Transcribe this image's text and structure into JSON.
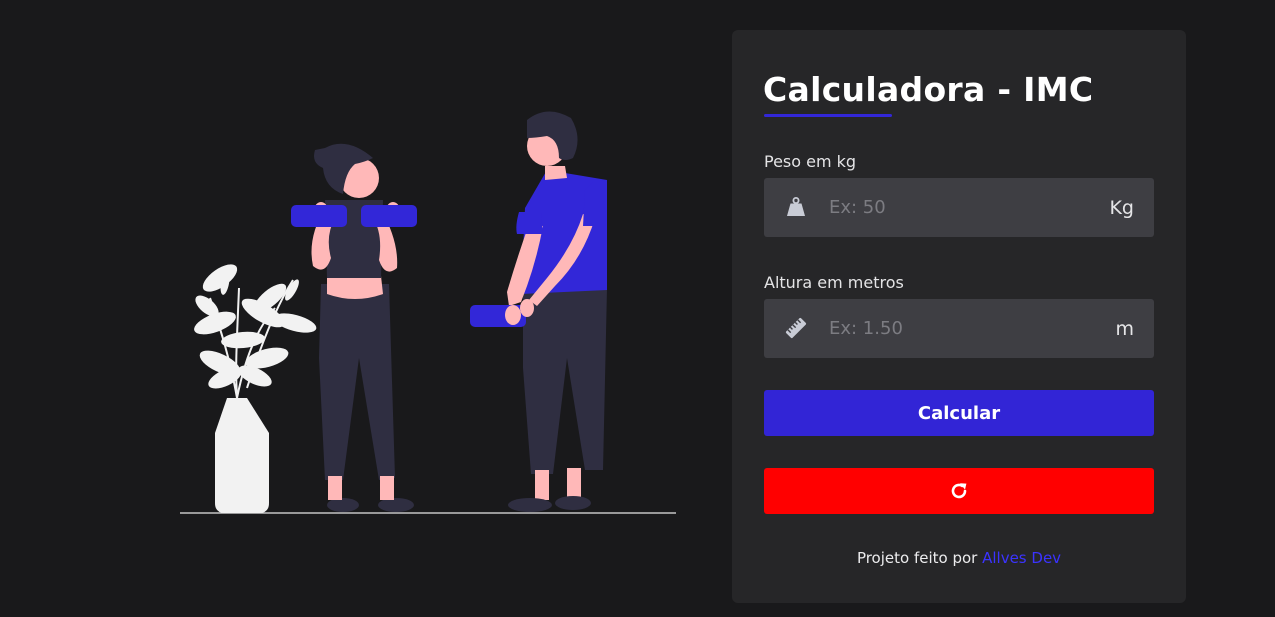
{
  "form": {
    "title": "Calculadora - IMC",
    "weight": {
      "label": "Peso em kg",
      "placeholder": "Ex: 50",
      "value": "",
      "unit": "Kg",
      "icon": "weight-icon"
    },
    "height": {
      "label": "Altura em metros",
      "placeholder": "Ex: 1.50",
      "value": "",
      "unit": "m",
      "icon": "ruler-icon"
    },
    "calculate_label": "Calcular",
    "reset_icon": "rotate-right-icon"
  },
  "footer": {
    "text": "Projeto feito por",
    "author_link": "Allves Dev"
  },
  "colors": {
    "background": "#19191b",
    "panel": "#262628",
    "input": "#3e3e43",
    "accent": "#3225d6",
    "danger": "#ff0000",
    "link": "#3b33ff"
  }
}
